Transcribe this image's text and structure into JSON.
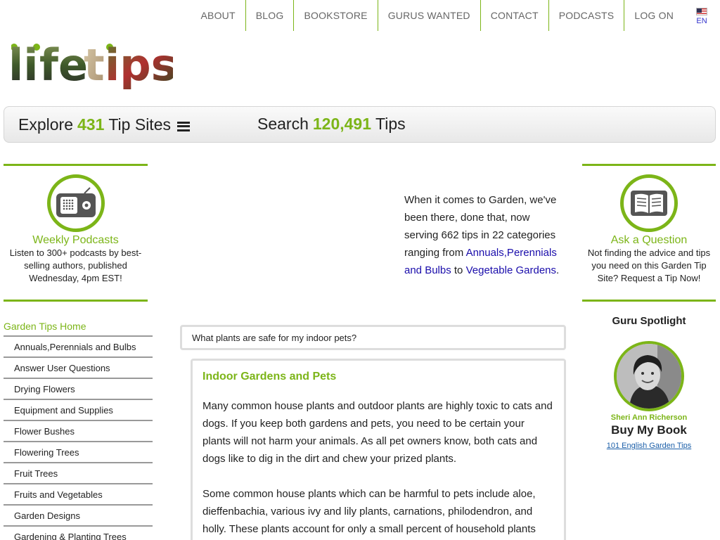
{
  "nav": {
    "items": [
      "ABOUT",
      "BLOG",
      "BOOKSTORE",
      "GURUS WANTED",
      "CONTACT",
      "PODCASTS",
      "LOG ON"
    ],
    "lang": "EN"
  },
  "logo": {
    "text": "lifetips"
  },
  "bar": {
    "explore_prefix": "Explore",
    "explore_count": "431",
    "explore_suffix": "Tip Sites",
    "search_prefix": "Search",
    "search_count": "120,491",
    "search_suffix": "Tips"
  },
  "podcasts": {
    "title": "Weekly Podcasts",
    "desc": "Listen to 300+ podcasts by best-selling authors, published Wednesday, 4pm EST!"
  },
  "ask": {
    "title": "Ask a Question",
    "desc": "Not finding the advice and tips you need on this Garden Tip Site? Request a Tip Now!"
  },
  "intro": {
    "text": "When it comes to Garden, we've been there, done that, now serving 662 tips in 22 categories ranging from",
    "link1": "Annuals,Perennials and Bulbs",
    "mid": "to",
    "link2": "Vegetable Gardens",
    "end": "."
  },
  "sidebar": {
    "home": "Garden Tips Home",
    "items": [
      "Annuals,Perennials and Bulbs",
      "Answer User Questions",
      "Drying Flowers",
      "Equipment and Supplies",
      "Flower Bushes",
      "Flowering Trees",
      "Fruit Trees",
      "Fruits and Vegetables",
      "Garden Designs",
      "Gardening & Planting Trees"
    ]
  },
  "question": {
    "text": "What plants are safe for my indoor pets?"
  },
  "tip": {
    "title": "Indoor Gardens and Pets",
    "p1": "Many common house plants and outdoor plants are highly toxic to cats and dogs. If you keep both gardens and pets, you need to be certain your plants will not harm your animals. As all pet owners know, both cats and dogs like to dig in the dirt and chew your prized plants.",
    "p2": "Some common house plants which can be harmful to pets include aloe, dieffenbachia, various ivy and lily plants, carnations, philodendron, and holly. These plants account for only a small percent of household plants"
  },
  "guru": {
    "heading": "Guru Spotlight",
    "name": "Sheri Ann Richerson",
    "buy": "Buy My Book",
    "book": "101 English Garden Tips"
  },
  "colors": {
    "accent": "#7cb518",
    "link": "#1a0dab"
  }
}
